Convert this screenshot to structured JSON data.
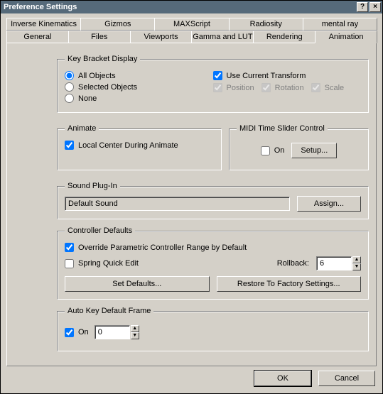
{
  "window": {
    "title": "Preference Settings",
    "help_glyph": "?",
    "close_glyph": "×"
  },
  "tabs": {
    "row1": [
      "Inverse Kinematics",
      "Gizmos",
      "MAXScript",
      "Radiosity",
      "mental ray"
    ],
    "row2": [
      "General",
      "Files",
      "Viewports",
      "Gamma and LUT",
      "Rendering",
      "Animation"
    ]
  },
  "key_bracket": {
    "legend": "Key Bracket Display",
    "all_objects": "All Objects",
    "selected_objects": "Selected Objects",
    "none": "None",
    "use_current_transform": "Use Current Transform",
    "position": "Position",
    "rotation": "Rotation",
    "scale": "Scale"
  },
  "animate": {
    "legend": "Animate",
    "local_center": "Local Center During Animate"
  },
  "midi": {
    "legend": "MIDI Time Slider Control",
    "on": "On",
    "setup": "Setup..."
  },
  "sound": {
    "legend": "Sound Plug-In",
    "value": "Default Sound",
    "assign": "Assign..."
  },
  "controller": {
    "legend": "Controller Defaults",
    "override": "Override Parametric Controller Range by Default",
    "spring": "Spring Quick Edit",
    "rollback_label": "Rollback:",
    "rollback_value": "6",
    "set_defaults": "Set Defaults...",
    "restore_factory": "Restore To Factory Settings..."
  },
  "autokey": {
    "legend": "Auto Key Default Frame",
    "on": "On",
    "value": "0"
  },
  "buttons": {
    "ok": "OK",
    "cancel": "Cancel"
  }
}
